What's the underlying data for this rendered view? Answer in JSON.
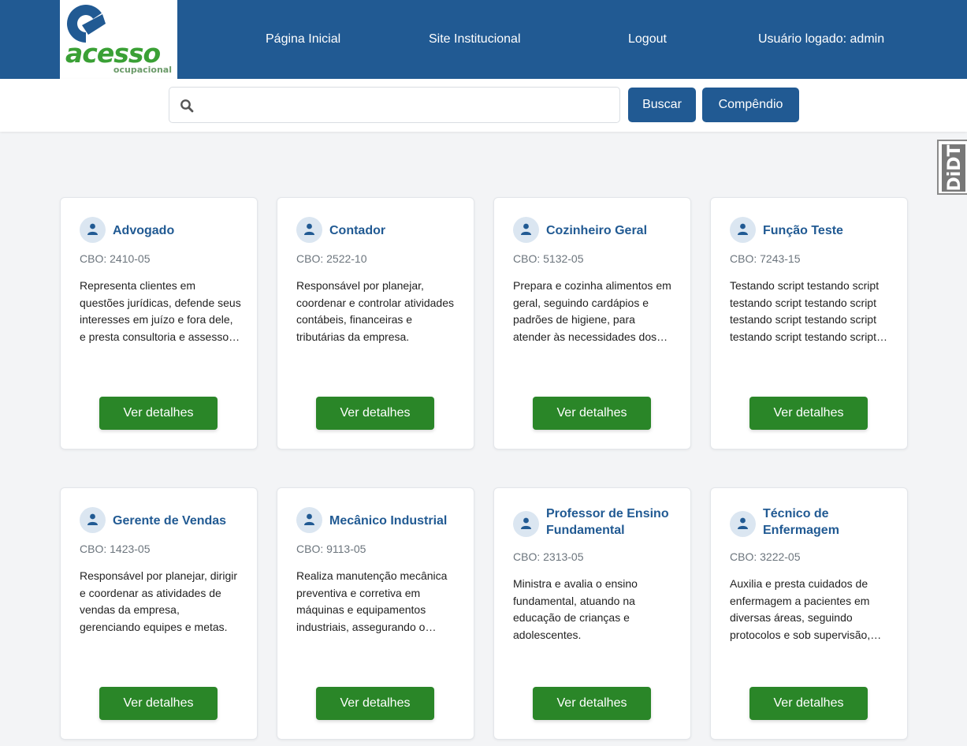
{
  "brand": {
    "logo_word": "acesso",
    "logo_sub": "ocupacional",
    "primary_color": "#215a93",
    "accent_green": "#2a8628"
  },
  "nav": {
    "home": "Página Inicial",
    "site": "Site Institucional",
    "logout": "Logout",
    "user": "Usuário logado: admin"
  },
  "search": {
    "placeholder": "",
    "value": "",
    "button_label": "Buscar",
    "compendio_label": "Compêndio"
  },
  "accessibility_widget": {
    "label": "DiDT"
  },
  "cards": [
    {
      "title": "Advogado",
      "cbo": "CBO: 2410-05",
      "description": "Representa clientes em questões jurídicas, defende seus interesses em juízo e fora dele, e presta consultoria e assessoria jurídica.",
      "button": "Ver detalhes"
    },
    {
      "title": "Contador",
      "cbo": "CBO: 2522-10",
      "description": "Responsável por planejar, coordenar e controlar atividades contábeis, financeiras e tributárias da empresa.",
      "button": "Ver detalhes"
    },
    {
      "title": "Cozinheiro Geral",
      "cbo": "CBO: 5132-05",
      "description": "Prepara e cozinha alimentos em geral, seguindo cardápios e padrões de higiene, para atender às necessidades dos clientes.",
      "button": "Ver detalhes"
    },
    {
      "title": "Função Teste",
      "cbo": "CBO: 7243-15",
      "description": "Testando script testando script testando script testando script testando script testando script testando script testando script testando script.",
      "button": "Ver detalhes"
    },
    {
      "title": "Gerente de Vendas",
      "cbo": "CBO: 1423-05",
      "description": "Responsável por planejar, dirigir e coordenar as atividades de vendas da empresa, gerenciando equipes e metas.",
      "button": "Ver detalhes"
    },
    {
      "title": "Mecânico Industrial",
      "cbo": "CBO: 9113-05",
      "description": "Realiza manutenção mecânica preventiva e corretiva em máquinas e equipamentos industriais, assegurando o funcionamento.",
      "button": "Ver detalhes"
    },
    {
      "title": "Professor de Ensino Fundamental",
      "cbo": "CBO: 2313-05",
      "description": "Ministra e avalia o ensino fundamental, atuando na educação de crianças e adolescentes.",
      "button": "Ver detalhes"
    },
    {
      "title": "Técnico de Enfermagem",
      "cbo": "CBO: 3222-05",
      "description": "Auxilia e presta cuidados de enfermagem a pacientes em diversas áreas, seguindo protocolos e sob supervisão, garantindo o bem-estar.",
      "button": "Ver detalhes"
    }
  ]
}
